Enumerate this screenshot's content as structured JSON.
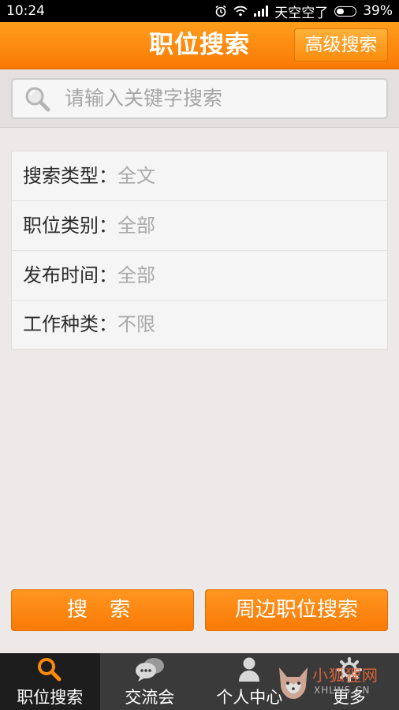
{
  "status_bar": {
    "time": "10:24",
    "carrier": "天空空了",
    "battery": "39%",
    "battery_level": 0.39
  },
  "header": {
    "title": "职位搜索",
    "advanced_button": "高级搜索"
  },
  "search": {
    "placeholder": "请输入关键字搜索"
  },
  "filters": [
    {
      "label": "搜索类型：",
      "value": "全文"
    },
    {
      "label": "职位类别：",
      "value": "全部"
    },
    {
      "label": "发布时间：",
      "value": "全部"
    },
    {
      "label": "工作种类：",
      "value": "不限"
    }
  ],
  "actions": {
    "search_button": "搜 索",
    "nearby_button": "周边职位搜索"
  },
  "bottom_nav": [
    {
      "label": "职位搜索",
      "icon": "search-icon",
      "active": true
    },
    {
      "label": "交流会",
      "icon": "chat-icon",
      "active": false
    },
    {
      "label": "个人中心",
      "icon": "person-icon",
      "active": false
    },
    {
      "label": "更多",
      "icon": "gear-icon",
      "active": false
    }
  ],
  "watermark": {
    "text": "小狐狸网",
    "sub": "XHLW5.CN"
  },
  "colors": {
    "accent": "#f98a0e",
    "nav_bg": "#3a3a3a",
    "nav_active": "#1d1d1d"
  }
}
